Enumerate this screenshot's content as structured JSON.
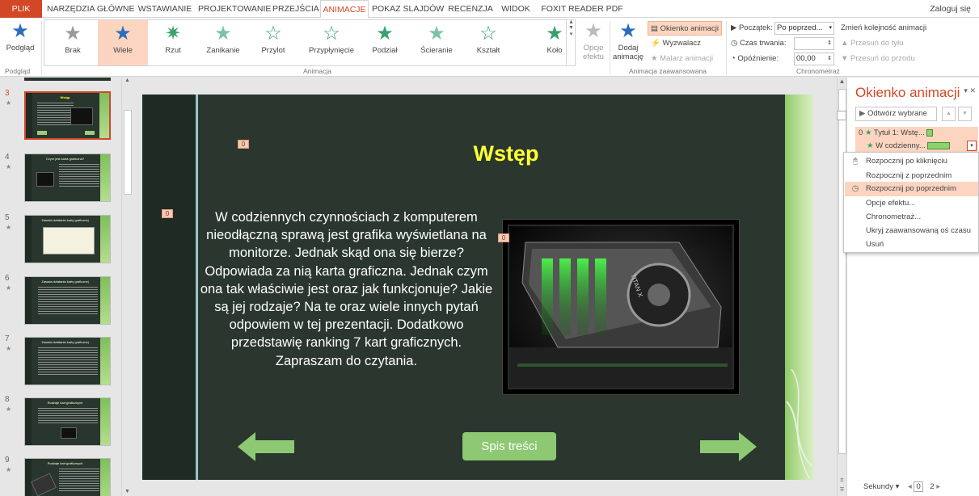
{
  "tabs": [
    {
      "label": "PLIK"
    },
    {
      "label": "NARZĘDZIA GŁÓWNE"
    },
    {
      "label": "WSTAWIANIE"
    },
    {
      "label": "PROJEKTOWANIE"
    },
    {
      "label": "PRZEJŚCIA"
    },
    {
      "label": "ANIMACJE"
    },
    {
      "label": "POKAZ SLAJDÓW"
    },
    {
      "label": "RECENZJA"
    },
    {
      "label": "WIDOK"
    },
    {
      "label": "FOXIT READER PDF"
    }
  ],
  "login": "Zaloguj się",
  "ribbon": {
    "preview": {
      "label": "Podgląd",
      "group": "Podgląd"
    },
    "gallery": [
      {
        "label": "Brak",
        "color": "#9a9a9a",
        "icon": "star-icon"
      },
      {
        "label": "Wiele",
        "color": "#2a6ebb",
        "icon": "star-icon"
      },
      {
        "label": "Rzut",
        "color": "#3aa16e",
        "icon": "star-burst-icon"
      },
      {
        "label": "Zanikanie",
        "color": "#3aa16e",
        "icon": "star-icon"
      },
      {
        "label": "Przylot",
        "color": "#3aa16e",
        "icon": "star-icon"
      },
      {
        "label": "Przypłynięcie",
        "color": "#3aa16e",
        "icon": "star-icon"
      },
      {
        "label": "Podział",
        "color": "#3aa16e",
        "icon": "star-icon"
      },
      {
        "label": "Ścieranie",
        "color": "#3aa16e",
        "icon": "star-icon"
      },
      {
        "label": "Kształt",
        "color": "#3aa16e",
        "icon": "star-icon"
      },
      {
        "label": "Koło",
        "color": "#3aa16e",
        "icon": "star-icon"
      }
    ],
    "effect_options": "Opcje efektu",
    "group_animation": "Animacja",
    "add_animation": "Dodaj animację",
    "animation_pane_btn": "Okienko animacji",
    "trigger": "Wyzwalacz",
    "painter": "Malarz animacji",
    "group_advanced": "Animacja zaawansowana",
    "start_label": "Początek:",
    "start_value": "Po poprzed...",
    "duration_label": "Czas trwania:",
    "duration_value": "",
    "delay_label": "Opóźnienie:",
    "delay_value": "00,00",
    "group_timing": "Chronometraż",
    "reorder_label": "Zmień kolejność animacji",
    "move_earlier": "Przesuń do tyłu",
    "move_later": "Przesuń do przodu"
  },
  "thumbnails": [
    {
      "num": "3",
      "title": "Wstęp"
    },
    {
      "num": "4",
      "title": "Czym jest karta graficzna?"
    },
    {
      "num": "5",
      "title": "Zasada działania karty graficznej"
    },
    {
      "num": "6",
      "title": "Zasada działania karty graficznej"
    },
    {
      "num": "7",
      "title": "Zasada działania karty graficznej"
    },
    {
      "num": "8",
      "title": "Rodzaje kart graficznych"
    },
    {
      "num": "9",
      "title": "Rodzaje kart graficznych"
    }
  ],
  "slide": {
    "title": "Wstęp",
    "body": "W codziennych czynnościach z komputerem nieodłączną sprawą jest grafika wyświetlana na monitorze. Jednak skąd ona się bierze? Odpowiada za nią karta graficzna. Jednak czym ona tak właściwie jest oraz jak funkcjonuje? Jakie są jej rodzaje? Na te oraz wiele innych pytań odpowiem w tej prezentacji. Dodatkowo przedstawię ranking 7 kart graficznych. Zapraszam do czytania.",
    "toc_button": "Spis treści",
    "tag_title": "0",
    "tag_body": "0",
    "tag_image": "0",
    "image_label": "TITAN X"
  },
  "anim_pane": {
    "title": "Okienko animacji",
    "play_button": "Odtwórz wybrane",
    "item_number": "0",
    "item_title": "Tytuł 1: Wstę...",
    "sub_item": "W codzienny...",
    "footer_label": "Sekundy",
    "timeline_start": "0",
    "timeline_next": "2"
  },
  "context_menu": [
    {
      "label": "Rozpocznij po kliknięciu",
      "icon": "mouse-icon"
    },
    {
      "label": "Rozpocznij z poprzednim",
      "icon": ""
    },
    {
      "label": "Rozpocznij po poprzednim",
      "icon": "clock-icon"
    },
    {
      "label": "Opcje efektu...",
      "icon": ""
    },
    {
      "label": "Chronometraż...",
      "icon": ""
    },
    {
      "label": "Ukryj zaawansowaną oś czasu",
      "icon": ""
    },
    {
      "label": "Usuń",
      "icon": ""
    }
  ],
  "colors": {
    "accent": "#d24726",
    "slide_bg": "#2a362e",
    "slide_title": "#ffff33",
    "slide_green": "#8dc873",
    "highlight": "#fcd5c0"
  }
}
